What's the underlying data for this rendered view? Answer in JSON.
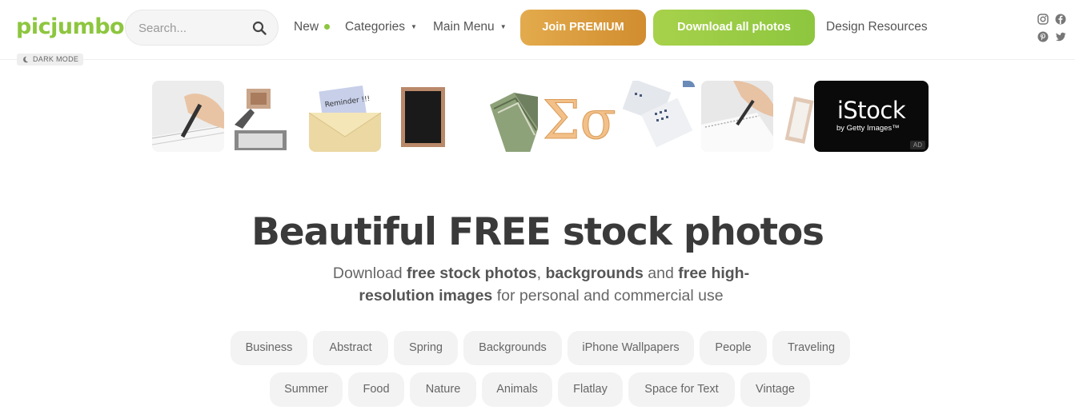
{
  "header": {
    "logo": "picjumbo",
    "search_placeholder": "Search...",
    "nav": {
      "new": "New",
      "categories": "Categories",
      "main_menu": "Main Menu",
      "design_resources": "Design Resources"
    },
    "buttons": {
      "premium": "Join PREMIUM",
      "download_all": "Download all photos"
    },
    "dark_mode": "DARK MODE",
    "social_icons": [
      "instagram-icon",
      "facebook-icon",
      "pinterest-icon",
      "twitter-icon"
    ]
  },
  "ad": {
    "brand": "iStock",
    "subtitle": "by Getty Images™",
    "label": "AD"
  },
  "thumbnails": [
    "pencil-on-notebook",
    "robot-hand-calculator",
    "reminder-envelope",
    "chalkboard",
    "dollar-bills",
    "sigma-letters",
    "calendar-pages",
    "pencil-on-notebook-2",
    "photo-frame"
  ],
  "thumbnail_text": {
    "envelope_note": "Reminder !!!",
    "sigma": "Σσ"
  },
  "hero": {
    "title": "Beautiful FREE stock photos",
    "sub": {
      "t1": "Download ",
      "b1": "free stock photos",
      "t2": ", ",
      "b2": "backgrounds",
      "t3": " and ",
      "b3": "free high-resolution images",
      "t4": " for personal and commercial use"
    }
  },
  "tags_row1": [
    "Business",
    "Abstract",
    "Spring",
    "Backgrounds",
    "iPhone Wallpapers",
    "People",
    "Traveling"
  ],
  "tags_row2": [
    "Summer",
    "Food",
    "Nature",
    "Animals",
    "Flatlay",
    "Space for Text",
    "Vintage"
  ],
  "colors": {
    "brand_green": "#8dc63f",
    "premium_orange": "#d99a3c",
    "text_dark": "#3a3a3a"
  }
}
